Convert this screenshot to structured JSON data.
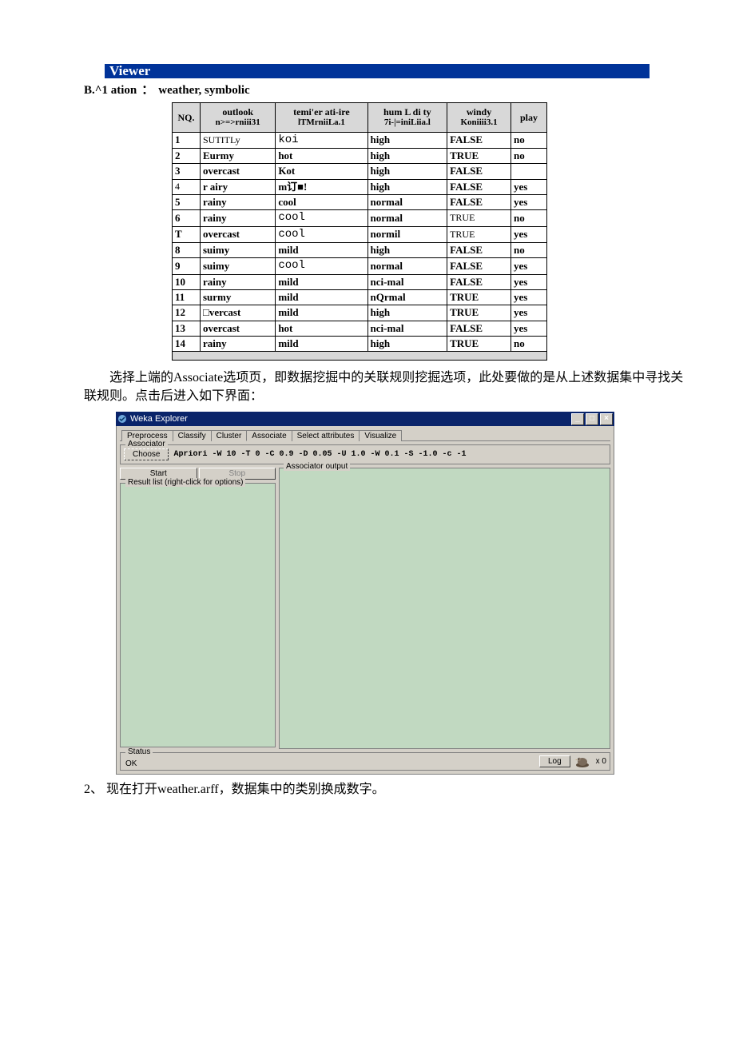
{
  "viewer_bar": "Viewer",
  "subheading": {
    "left": "B.^1 ation",
    "colon": "：",
    "right": "weather, symbolic"
  },
  "table_headers": [
    {
      "main": "NQ.",
      "sub": ""
    },
    {
      "main": "outlook",
      "sub": "n>=>rniii31"
    },
    {
      "main": "temi'er ati-ire",
      "sub": "lTMrniiLa.1"
    },
    {
      "main": "hum L di ty",
      "sub": "7i-|=iniLiia.l"
    },
    {
      "main": "windy",
      "sub": "Koniiii3.1"
    },
    {
      "main": "play",
      "sub": ""
    }
  ],
  "rows": [
    {
      "no": "1",
      "outlook": "SUTITLy",
      "outlook_style": "thin",
      "temp": "koi",
      "temp_style": "mono",
      "hum": "high",
      "windy": "FALSE",
      "play": "no"
    },
    {
      "no": "2",
      "outlook": "Eurmy",
      "temp": "hot",
      "hum": "high",
      "windy": "TRUE",
      "play": "no"
    },
    {
      "no": "3",
      "outlook": "overcast",
      "temp": "Kot",
      "hum": "high",
      "windy": "FALSE",
      "play": ""
    },
    {
      "no": "4",
      "no_style": "thin",
      "outlook": "r airy",
      "temp": "m订■!",
      "hum": "high",
      "windy": "FALSE",
      "play": "yes"
    },
    {
      "no": "5",
      "outlook": "rainy",
      "temp": "cool",
      "hum": "normal",
      "windy": "FALSE",
      "play": "yes"
    },
    {
      "no": "6",
      "outlook": "rainy",
      "temp": "cool",
      "temp_style": "mono",
      "hum": "normal",
      "windy": "TRUE",
      "windy_style": "thin",
      "play": "no"
    },
    {
      "no": "T",
      "outlook": "overcast",
      "temp": "cool",
      "temp_style": "mono",
      "hum": "normil",
      "windy": "TRUE",
      "windy_style": "thin",
      "play": "yes"
    },
    {
      "no": "8",
      "outlook": "suimy",
      "temp": "mild",
      "hum": "high",
      "windy": "FALSE",
      "play": "no"
    },
    {
      "no": "9",
      "outlook": "suimy",
      "temp": "cool",
      "temp_style": "mono",
      "hum": "normal",
      "windy": "FALSE",
      "play": "yes"
    },
    {
      "no": "10",
      "outlook": "rainy",
      "temp": "mild",
      "hum": "nci-mal",
      "windy": "FALSE",
      "play": "yes"
    },
    {
      "no": "11",
      "outlook": "surmy",
      "temp": "mild",
      "hum": "nQrmal",
      "windy": "TRUE",
      "play": "yes"
    },
    {
      "no": "12",
      "outlook": "□vercast",
      "temp": "mild",
      "hum": "high",
      "windy": "TRUE",
      "play": "yes"
    },
    {
      "no": "13",
      "outlook": "overcast",
      "temp": "hot",
      "hum": "nci-mal",
      "windy": "FALSE",
      "play": "yes"
    },
    {
      "no": "14",
      "outlook": "rainy",
      "temp": "mild",
      "hum": "high",
      "windy": "TRUE",
      "play": "no"
    }
  ],
  "paragraph1": "选择上端的Associate选项页，即数据挖掘中的关联规则挖掘选项，此处要做的是从上述数据集中寻找关联规则。点击后进入如下界面：",
  "weka": {
    "title": "Weka Explorer",
    "tabs": [
      "Preprocess",
      "Classify",
      "Cluster",
      "Associate",
      "Select attributes",
      "Visualize"
    ],
    "active_tab": 3,
    "associator_label": "Associator",
    "choose_label": "Choose",
    "algo_text": "Apriori -W 10 -T 0 -C 0.9 -D 0.05 -U 1.0 -W 0.1 -S -1.0 -c -1",
    "start_label": "Start",
    "stop_label": "Stop",
    "result_list_label": "Result list (right-click for options)",
    "output_label": "Associator output",
    "status_label": "Status",
    "status_text": "OK",
    "log_label": "Log",
    "x0": "x 0"
  },
  "paragraph2": {
    "idx": "2、",
    "text": "现在打开weather.arff，数据集中的类别换成数字。"
  }
}
